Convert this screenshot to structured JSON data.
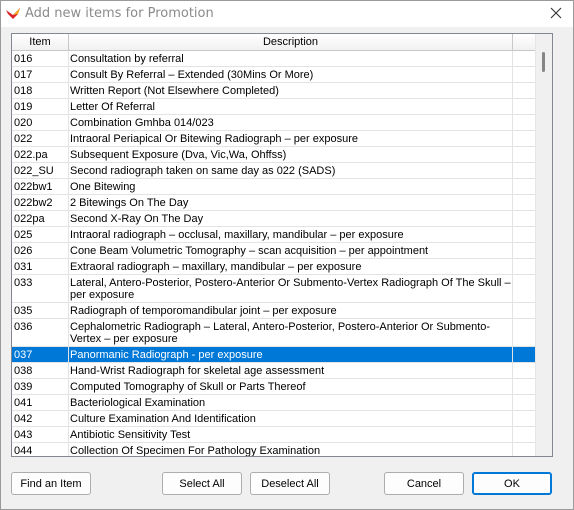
{
  "window": {
    "title": "Add new items for Promotion"
  },
  "icons": {
    "app": "app-logo-icon",
    "close": "close-icon"
  },
  "table": {
    "columns": [
      "Item",
      "Description"
    ],
    "selected_index": 20,
    "rows": [
      {
        "item": "016",
        "description": "Consultation by referral"
      },
      {
        "item": "017",
        "description": "Consult By Referral – Extended  (30Mins Or More)"
      },
      {
        "item": "018",
        "description": "Written Report (Not Elsewhere Completed)"
      },
      {
        "item": "019",
        "description": "Letter Of Referral"
      },
      {
        "item": "020",
        "description": "Combination Gmhba 014/023"
      },
      {
        "item": "022",
        "description": "Intraoral Periapical Or Bitewing Radiograph – per exposure"
      },
      {
        "item": "022.pa",
        "description": "Subsequent Exposure (Dva, Vic,Wa, Ohffss)"
      },
      {
        "item": "022_SU",
        "description": "Second radiograph taken on same day as 022 (SADS)"
      },
      {
        "item": "022bw1",
        "description": "One Bitewing"
      },
      {
        "item": "022bw2",
        "description": "2 Bitewings On The Day"
      },
      {
        "item": "022pa",
        "description": "Second X-Ray On The Day"
      },
      {
        "item": "025",
        "description": "Intraoral radiograph – occlusal, maxillary, mandibular – per exposure"
      },
      {
        "item": "026",
        "description": "Cone Beam Volumetric Tomography – scan acquisition – per appointment"
      },
      {
        "item": "031",
        "description": " Extraoral radiograph – maxillary, mandibular – per exposure"
      },
      {
        "item": "033",
        "description": "Lateral, Antero-Posterior, Postero-Anterior Or Submento-Vertex Radiograph Of The Skull – per exposure"
      },
      {
        "item": "035",
        "description": "Radiograph of temporomandibular joint – per exposure"
      },
      {
        "item": "036",
        "description": "Cephalometric Radiograph – Lateral, Antero-Posterior, Postero-Anterior Or Submento-Vertex – per exposure"
      },
      {
        "item": "037",
        "description": "Panormanic Radiograph - per exposure"
      },
      {
        "item": "038",
        "description": "Hand-Wrist Radiograph for skeletal age assessment"
      },
      {
        "item": "039",
        "description": "Computed Tomography of Skull or Parts Thereof"
      },
      {
        "item": "041",
        "description": "Bacteriological Examination"
      },
      {
        "item": "042",
        "description": "Culture Examination And Identification"
      },
      {
        "item": "043",
        "description": "Antibiotic Sensitivity Test"
      },
      {
        "item": "044",
        "description": "Collection Of Specimen For Pathology Examination"
      }
    ]
  },
  "buttons": {
    "find": "Find an Item",
    "select_all": "Select All",
    "deselect_all": "Deselect All",
    "cancel": "Cancel",
    "ok": "OK"
  }
}
